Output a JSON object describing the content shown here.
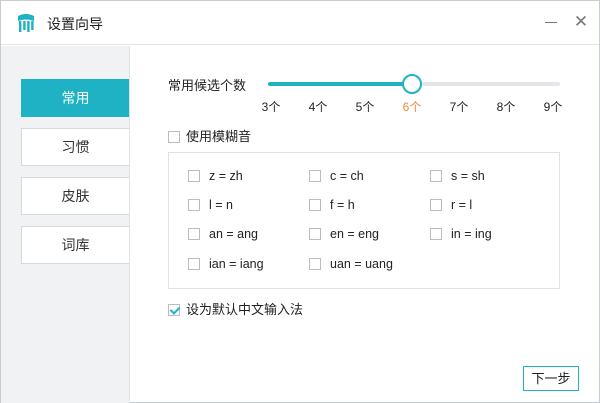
{
  "window": {
    "title": "设置向导"
  },
  "sidebar": {
    "items": [
      {
        "label": "常用",
        "active": true
      },
      {
        "label": "习惯",
        "active": false
      },
      {
        "label": "皮肤",
        "active": false
      },
      {
        "label": "词库",
        "active": false
      }
    ]
  },
  "candidates": {
    "label": "常用候选个数",
    "options": [
      "3个",
      "4个",
      "5个",
      "6个",
      "7个",
      "8个",
      "9个"
    ],
    "selected": "6个",
    "accent_color": "#1fb2c4",
    "selected_color": "#f08a3c"
  },
  "fuzzy": {
    "label": "使用模糊音",
    "checked": false,
    "options": [
      {
        "label": "z = zh",
        "checked": false
      },
      {
        "label": "c = ch",
        "checked": false
      },
      {
        "label": "s = sh",
        "checked": false
      },
      {
        "label": "l = n",
        "checked": false
      },
      {
        "label": "f = h",
        "checked": false
      },
      {
        "label": "r = l",
        "checked": false
      },
      {
        "label": "an = ang",
        "checked": false
      },
      {
        "label": "en = eng",
        "checked": false
      },
      {
        "label": "in = ing",
        "checked": false
      },
      {
        "label": "ian = iang",
        "checked": false
      },
      {
        "label": "uan = uang",
        "checked": false
      }
    ]
  },
  "default_ime": {
    "label": "设为默认中文输入法",
    "checked": true
  },
  "footer": {
    "next_label": "下一步"
  }
}
